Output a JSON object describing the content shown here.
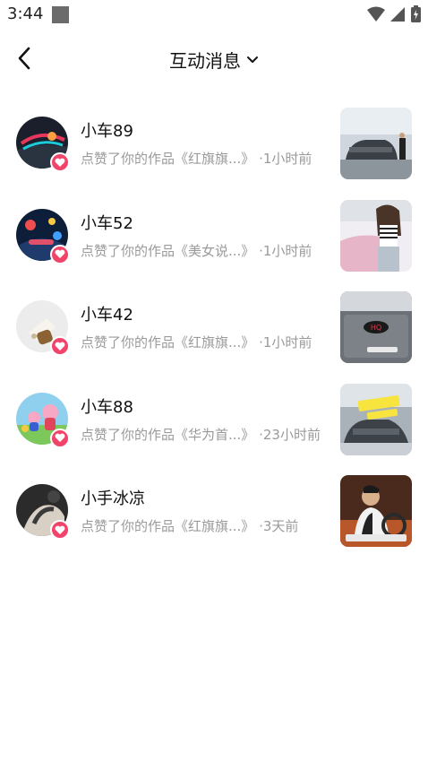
{
  "status_bar": {
    "time": "3:44"
  },
  "header": {
    "title": "互动消息"
  },
  "messages": [
    {
      "name": "小车89",
      "action": "点赞了你的作品《红旗旗...》",
      "time": "·1小时前"
    },
    {
      "name": "小车52",
      "action": "点赞了你的作品《美女说...》",
      "time": "·1小时前"
    },
    {
      "name": "小车42",
      "action": "点赞了你的作品《红旗旗...》",
      "time": "·1小时前"
    },
    {
      "name": "小车88",
      "action": "点赞了你的作品《华为首...》",
      "time": "·23小时前"
    },
    {
      "name": "小手冰凉",
      "action": "点赞了你的作品《红旗旗...》",
      "time": "·3天前"
    }
  ],
  "colors": {
    "badge": "#f0446a",
    "secondary_text": "#9a9a9a"
  }
}
